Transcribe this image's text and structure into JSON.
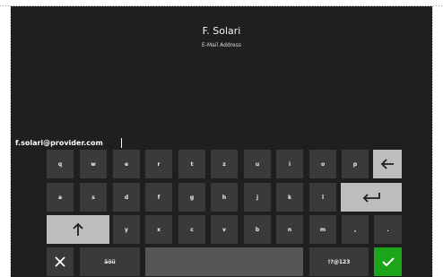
{
  "header": {
    "name": "F. Solari",
    "field_label": "E-Mail Address"
  },
  "input": {
    "value": "f.solari@provider.com"
  },
  "keyboard": {
    "row1": [
      "q",
      "w",
      "e",
      "r",
      "t",
      "z",
      "u",
      "i",
      "o",
      "p"
    ],
    "row2": [
      "a",
      "s",
      "d",
      "f",
      "g",
      "h",
      "j",
      "k",
      "l"
    ],
    "row3": [
      "y",
      "x",
      "c",
      "v",
      "b",
      "n",
      "m",
      ",",
      "."
    ],
    "lang_label": "äöü",
    "symbols_label": "!?@123",
    "icons": {
      "backspace": "arrow-left-icon",
      "enter": "enter-icon",
      "shift": "arrow-up-icon",
      "close": "close-icon",
      "confirm": "check-icon"
    },
    "colors": {
      "screen_bg": "#1f1f1f",
      "key_bg": "#3a3a3a",
      "action_key_bg": "#bdbdbd",
      "space_bg": "#565656",
      "confirm_bg": "#1da51a"
    }
  }
}
